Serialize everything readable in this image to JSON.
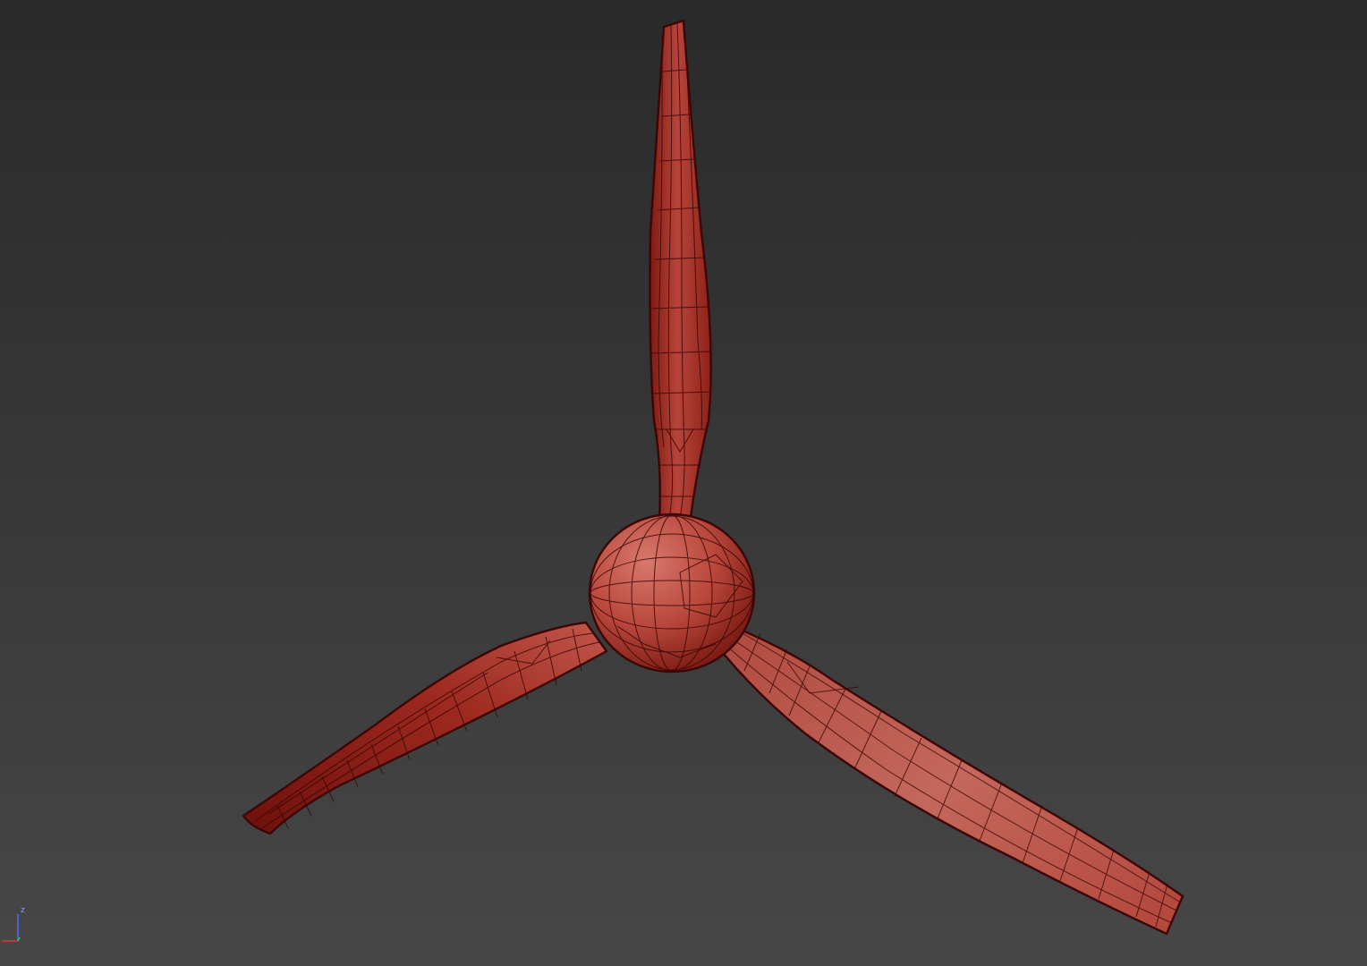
{
  "viewport": {
    "model": "three-blade-propeller",
    "shading": "smooth-with-wireframe-edges",
    "background_top": "#2a2a2a",
    "background_bottom": "#474747"
  },
  "colors": {
    "blade_dark": "#7a150f",
    "blade_mid": "#b03a2e",
    "blade_light": "#cf6a5e",
    "wire": "#3a0606",
    "axis_x": "#d63a3a",
    "axis_y": "#3acb3a",
    "axis_z": "#4a6cff"
  },
  "gizmo": {
    "z_label": "z"
  }
}
